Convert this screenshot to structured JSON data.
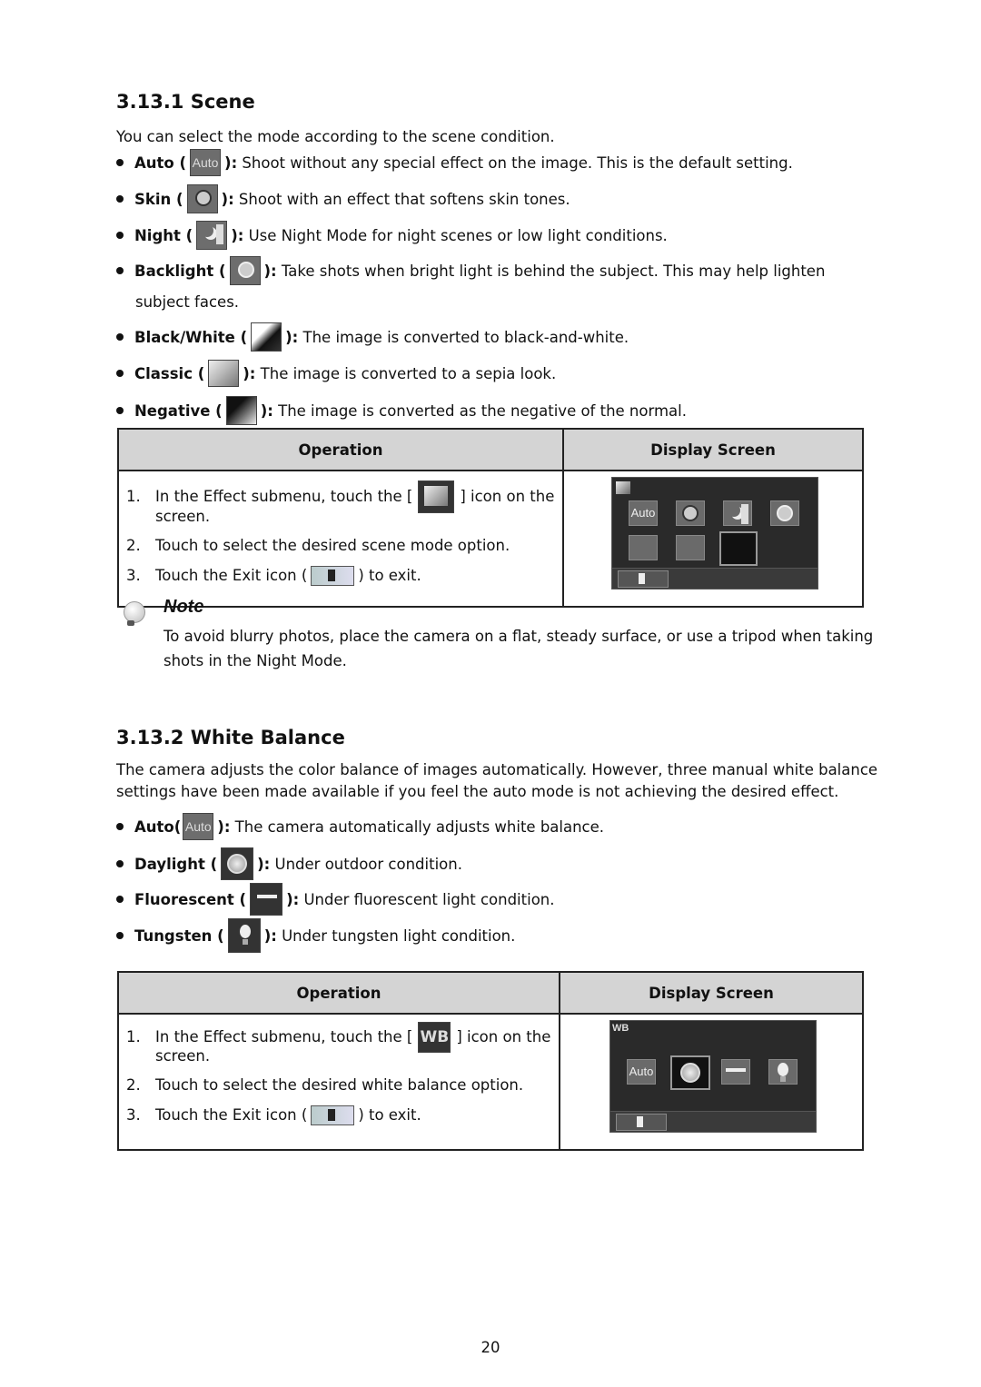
{
  "scene": {
    "heading": "3.13.1  Scene",
    "intro": "You can select the mode according to the scene condition.",
    "items": [
      {
        "label": "Auto (",
        "icon": "auto-icon",
        "icon_text": "Auto",
        "desc_sep": "):",
        "desc": " Shoot without any special effect on the image. This is the default setting."
      },
      {
        "label": "Skin (",
        "icon": "skin-face-icon",
        "desc_sep": "):",
        "desc": " Shoot with an effect that softens skin tones."
      },
      {
        "label": "Night (",
        "icon": "night-moon-building-icon",
        "desc_sep": "):",
        "desc": " Use Night Mode for night scenes or low light conditions."
      },
      {
        "label": "Backlight (",
        "icon": "backlight-face-icon",
        "desc_sep": "):",
        "desc": " Take shots when bright light is behind the subject. This may help lighten",
        "desc_cont": "subject faces."
      },
      {
        "label": "Black/White (",
        "icon": "black-white-icon",
        "desc_sep": "):",
        "desc": " The image is converted to black-and-white."
      },
      {
        "label": "Classic (",
        "icon": "classic-sepia-icon",
        "desc_sep": "):",
        "desc": " The image is converted to a sepia look."
      },
      {
        "label": "Negative (",
        "icon": "negative-icon",
        "desc_sep": "):",
        "desc": " The image is converted as the negative of the normal."
      }
    ],
    "table": {
      "col_operation": "Operation",
      "col_display": "Display Screen",
      "steps": [
        {
          "n": "1.",
          "pre": "In the Effect submenu, touch the [",
          "post": "] icon on the",
          "cont": "screen.",
          "icon": "scene-menu-icon"
        },
        {
          "n": "2.",
          "text": "Touch to select the desired scene mode option."
        },
        {
          "n": "3.",
          "pre": "Touch the Exit icon (",
          "post": ") to exit.",
          "icon": "exit-icon"
        }
      ],
      "screen_auto": "Auto"
    },
    "note": {
      "title": "Note",
      "line1": "To avoid blurry photos, place the camera on a flat, steady surface, or use a tripod when taking",
      "line2": "shots in the Night Mode."
    }
  },
  "wb": {
    "heading": "3.13.2  White Balance",
    "intro1": "The camera adjusts the color balance of images automatically. However, three manual white balance",
    "intro2": "settings have been made available if you feel the auto mode is not achieving the desired effect.",
    "items": [
      {
        "label": "Auto(",
        "icon": "auto-icon",
        "icon_text": "Auto",
        "desc_sep": "):",
        "desc": " The camera automatically adjusts white balance."
      },
      {
        "label": "Daylight (",
        "icon": "daylight-sun-icon",
        "desc_sep": "):",
        "desc": " Under outdoor condition."
      },
      {
        "label": "Fluorescent (",
        "icon": "fluorescent-tube-icon",
        "desc_sep": "):",
        "desc": " Under fluorescent light condition."
      },
      {
        "label": "Tungsten (",
        "icon": "tungsten-bulb-icon",
        "desc_sep": "):",
        "desc": " Under tungsten light condition."
      }
    ],
    "table": {
      "col_operation": "Operation",
      "col_display": "Display Screen",
      "steps": [
        {
          "n": "1.",
          "pre": "In the Effect submenu, touch the [",
          "post": "] icon on the",
          "cont": "screen.",
          "icon_text": "WB"
        },
        {
          "n": "2.",
          "text": "Touch to select the desired white balance option."
        },
        {
          "n": "3.",
          "pre": "Touch the Exit icon (",
          "post": ") to exit."
        }
      ],
      "screen_label": "WB",
      "screen_auto": "Auto"
    }
  },
  "page_number": "20"
}
